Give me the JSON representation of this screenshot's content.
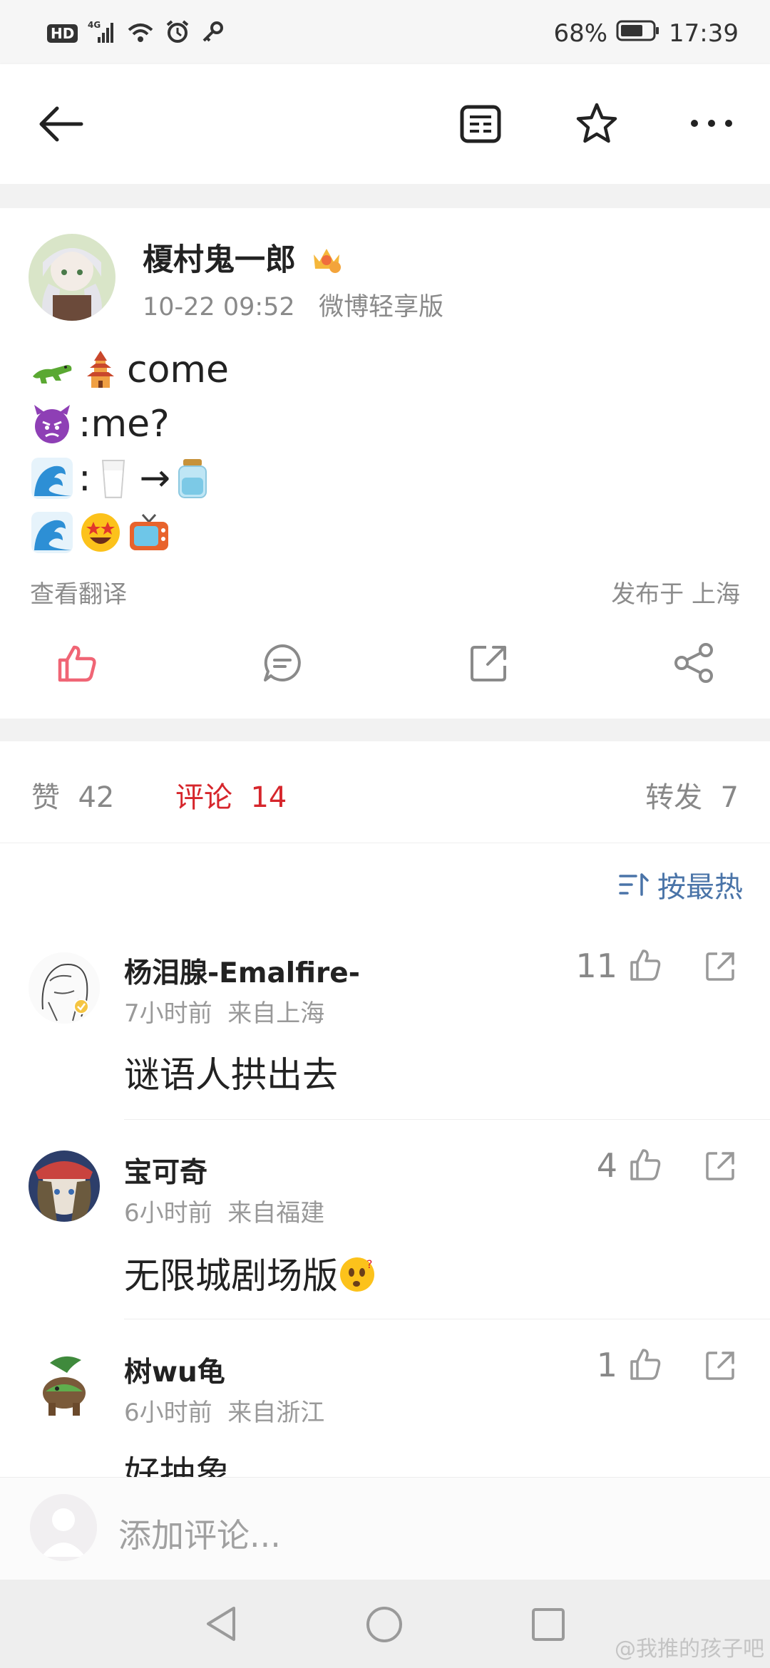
{
  "status_bar": {
    "hd": "HD",
    "net": "4G",
    "battery": "68%",
    "time": "17:39"
  },
  "post": {
    "author": "榎村鬼一郎",
    "time": "10-22 09:52",
    "source": "微博轻享版",
    "lines": {
      "line1_text": "come",
      "line2_text": ":me?",
      "line3_colon": ":",
      "line3_arrow": "→"
    },
    "translate_label": "查看翻译",
    "location": "发布于 上海"
  },
  "stats": {
    "likes_label": "赞",
    "likes": "42",
    "comments_label": "评论",
    "comments": "14",
    "reposts_label": "转发",
    "reposts": "7"
  },
  "sort_label": "按最热",
  "comments": [
    {
      "name": "杨泪腺-Emalfire-",
      "time": "7小时前",
      "from": "来自上海",
      "text": "谜语人拱出去",
      "likes": "11"
    },
    {
      "name": "宝可奇",
      "time": "6小时前",
      "from": "来自福建",
      "text": "无限城剧场版",
      "likes": "4"
    },
    {
      "name": "树wu龟",
      "time": "6小时前",
      "from": "来自浙江",
      "text": "好抽象",
      "likes": "1"
    }
  ],
  "input_placeholder": "添加评论...",
  "watermark": "@我推的孩子吧",
  "colors": {
    "accent_red": "#d6262c",
    "like_pink": "#f06575",
    "sort_blue": "#4a74a8"
  }
}
